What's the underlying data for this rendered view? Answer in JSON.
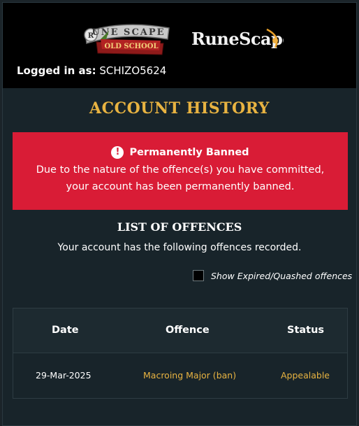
{
  "header": {
    "logo_osrs_alt": "RuneScape Old School",
    "logo_rs_alt": "RuneScape",
    "logged_in_label": "Logged in as:",
    "username": "SCHIZO5624"
  },
  "page_title": "ACCOUNT HISTORY",
  "alert": {
    "icon": "exclamation-circle-icon",
    "title": "Permanently Banned",
    "line1": "Due to the nature of the offence(s) you have committed,",
    "line2": "your account has been permanently banned.",
    "color": "#d91c36"
  },
  "offences": {
    "title": "LIST OF OFFENCES",
    "subtitle": "Your account has the following offences recorded.",
    "show_expired_label": "Show Expired/Quashed offences",
    "show_expired_checked": false,
    "columns": [
      "Date",
      "Offence",
      "Status"
    ],
    "rows": [
      {
        "date": "29-Mar-2025",
        "offence": "Macroing Major (ban)",
        "status": "Appealable"
      }
    ]
  },
  "colors": {
    "accent": "#e8b341",
    "background": "#18242a"
  }
}
